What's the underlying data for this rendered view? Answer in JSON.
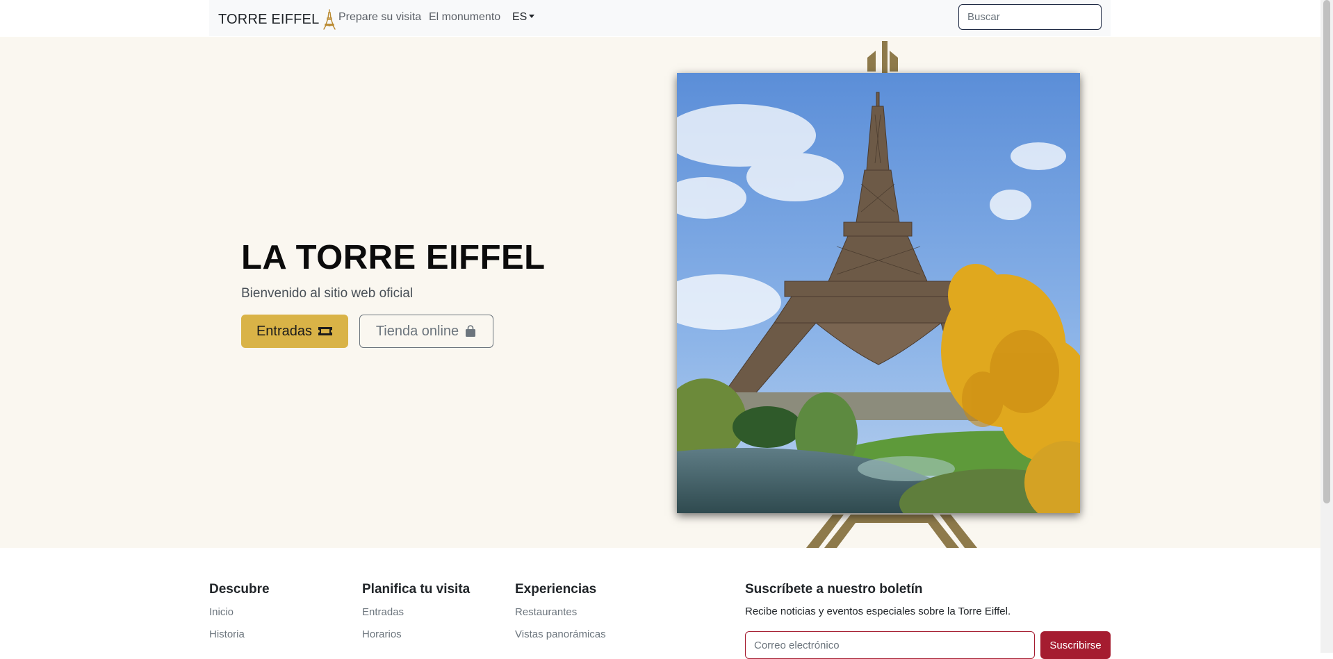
{
  "nav": {
    "brand": "TORRE EIFFEL",
    "links": [
      "Prepare su visita",
      "El monumento"
    ],
    "lang": "ES",
    "search_placeholder": "Buscar"
  },
  "hero": {
    "title": "LA TORRE EIFFEL",
    "subtitle": "Bienvenido al sitio web oficial",
    "btn_tickets": "Entradas",
    "btn_shop": "Tienda online",
    "image_alt": "Eiffel Tower with autumn trees and pond"
  },
  "footer": {
    "cols": [
      {
        "title": "Descubre",
        "links": [
          "Inicio",
          "Historia"
        ]
      },
      {
        "title": "Planifica tu visita",
        "links": [
          "Entradas",
          "Horarios"
        ]
      },
      {
        "title": "Experiencias",
        "links": [
          "Restaurantes",
          "Vistas panorámicas"
        ]
      }
    ],
    "newsletter": {
      "title": "Suscríbete a nuestro boletín",
      "text": "Recibe noticias y eventos especiales sobre la Torre Eiffel.",
      "placeholder": "Correo electrónico",
      "button": "Suscribirse"
    }
  },
  "colors": {
    "primary": "#d9b347",
    "accent_red": "#a51c30",
    "hero_bg": "#faf7f0",
    "deco": "#8e7a4b"
  },
  "icons": {
    "brand": "eiffel-tower-icon",
    "ticket": "ticket-icon",
    "shop": "shopping-bag-icon",
    "lang_caret": "caret-down-icon"
  }
}
